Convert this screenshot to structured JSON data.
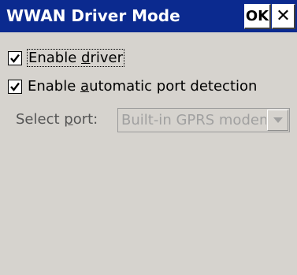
{
  "window": {
    "title": "WWAN Driver Mode",
    "ok_label": "OK",
    "close_glyph": "✕"
  },
  "options": {
    "enable_driver": {
      "label_pre": "Enable ",
      "label_accel": "d",
      "label_post": "river",
      "checked": true
    },
    "auto_port": {
      "label_pre": "Enable ",
      "label_accel": "a",
      "label_post": "utomatic port detection",
      "checked": true
    }
  },
  "port": {
    "label_pre": "Select ",
    "label_accel": "p",
    "label_post": "ort:",
    "value": "Built-in GPRS modem",
    "enabled": false
  },
  "colors": {
    "titlebar": "#0b2a8f",
    "dialog_bg": "#d6d3ce",
    "disabled_text": "#a0a0a0"
  },
  "icons": {
    "check": "check-icon",
    "dropdown": "chevron-down-icon",
    "close": "close-icon"
  }
}
